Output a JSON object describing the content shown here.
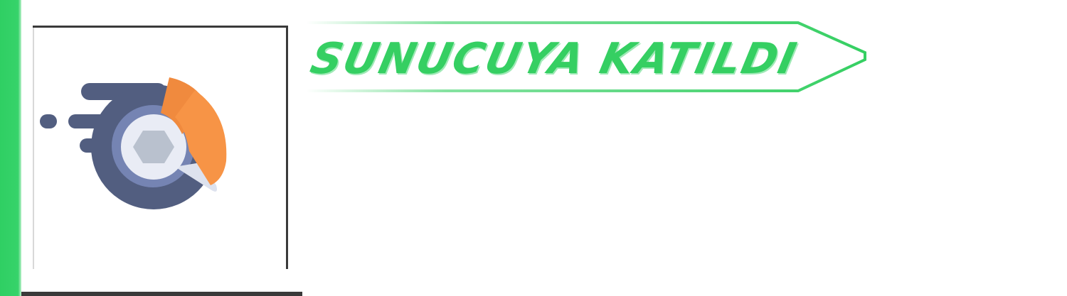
{
  "banner": {
    "title": "SUNUCUYA KATILDI"
  },
  "avatar": {
    "icon": "disk-magnifier-icon"
  },
  "colors": {
    "accent": "#35cf62",
    "icon_dark": "#525e80",
    "icon_mid": "#7584b3",
    "icon_light": "#e9ecf5",
    "icon_hex": "#b9c1ce",
    "icon_orange": "#f79446",
    "icon_orange_dark": "#f08a3e"
  }
}
